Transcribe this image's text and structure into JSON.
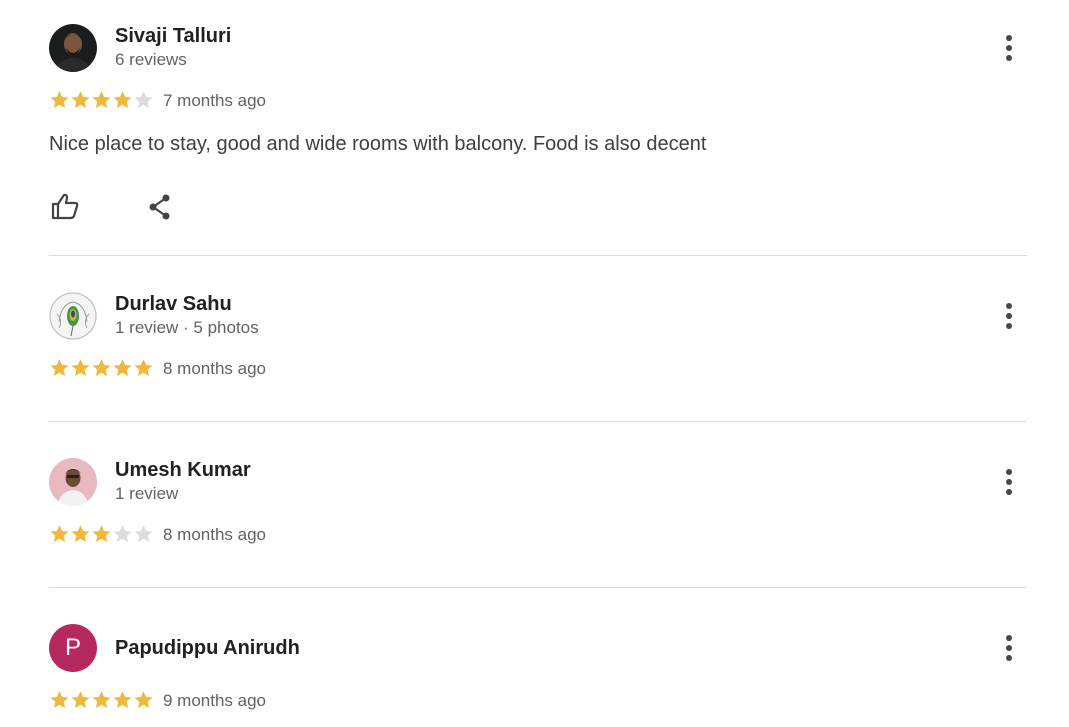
{
  "colors": {
    "star_filled": "#f0b93c",
    "star_empty": "#dadce0",
    "avatar_p": "#b5295f",
    "text_primary": "#202124",
    "text_secondary": "#5f6368",
    "divider": "#dadce0"
  },
  "reviews": [
    {
      "name": "Sivaji Talluri",
      "meta": "6 reviews",
      "rating": 4,
      "date": "7 months ago",
      "text": "Nice place to stay, good and wide rooms with balcony. Food is also decent",
      "avatar": "photo-dark-portrait",
      "actions": [
        "like-icon",
        "share-icon"
      ]
    },
    {
      "name": "Durlav Sahu",
      "meta": "1 review · 5 photos",
      "rating": 5,
      "date": "8 months ago",
      "avatar": "peacock-feather-sketch"
    },
    {
      "name": "Umesh Kumar",
      "meta": "1 review",
      "rating": 3,
      "date": "8 months ago",
      "avatar": "photo-person-pink-bg"
    },
    {
      "name": "Papudippu Anirudh",
      "rating": 5,
      "date": "9 months ago",
      "avatar_letter": "P"
    }
  ],
  "icons": {
    "more": "more-vertical-icon",
    "star": "star-icon"
  }
}
